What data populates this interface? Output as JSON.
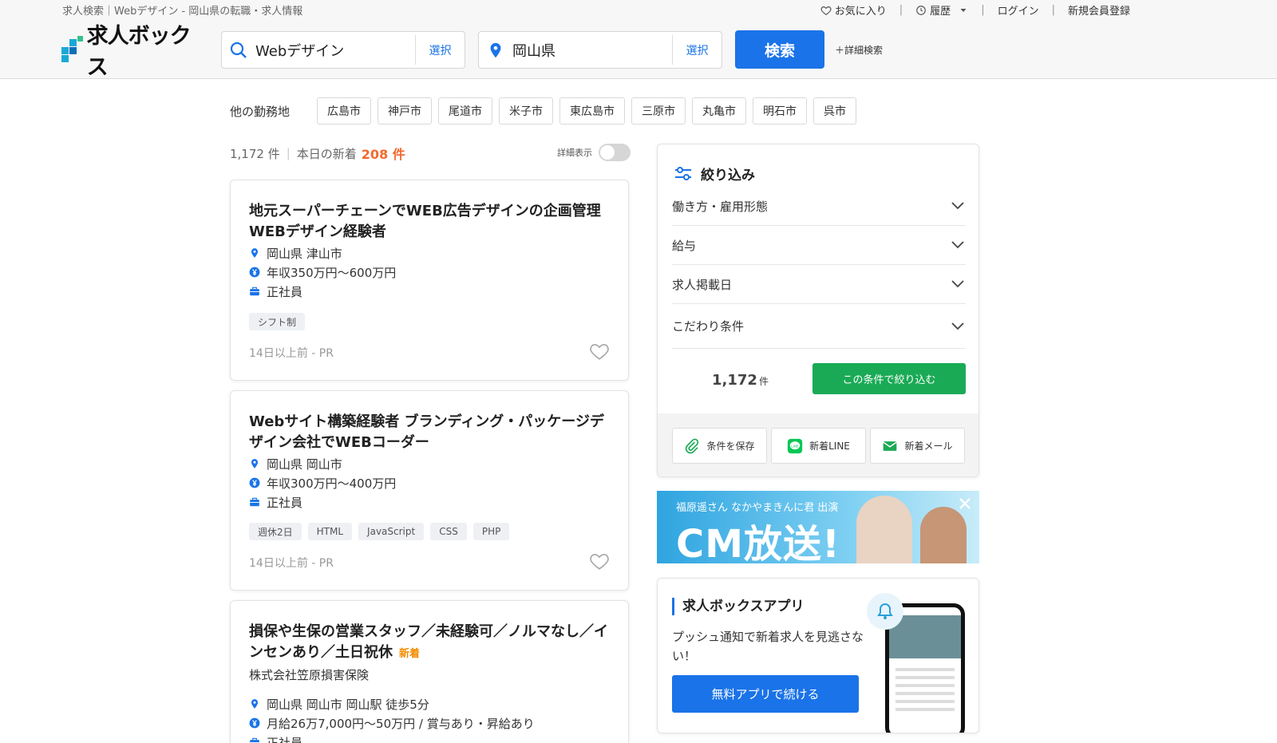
{
  "header": {
    "breadcrumb": "求人検索｜Webデザイン - 岡山県の転職・求人情報",
    "links": {
      "favorites": "お気に入り",
      "history": "履歴",
      "login": "ログイン",
      "signup": "新規会員登録"
    },
    "logo_text": "求人ボックス",
    "keyword_value": "Webデザイン",
    "keyword_select": "選択",
    "location_value": "岡山県",
    "location_select": "選択",
    "search_button": "検索",
    "advanced_search": "＋詳細検索"
  },
  "locations": {
    "label": "他の勤務地",
    "chips": [
      "広島市",
      "神戸市",
      "尾道市",
      "米子市",
      "東広島市",
      "三原市",
      "丸亀市",
      "明石市",
      "呉市"
    ]
  },
  "results": {
    "count": "1,172 件",
    "today_label": "本日の新着",
    "today_count": "208 件",
    "detail_toggle_label": "詳細表示"
  },
  "jobs": [
    {
      "title": "地元スーパーチェーンでWEB広告デザインの企画管理 WEBデザイン経験者",
      "location": "岡山県 津山市",
      "salary": "年収350万円〜600万円",
      "type": "正社員",
      "tags": [
        "シフト制"
      ],
      "posted": "14日以上前 - PR"
    },
    {
      "title": "Webサイト構築経験者 ブランディング・パッケージデザイン会社でWEBコーダー",
      "location": "岡山県 岡山市",
      "salary": "年収300万円〜400万円",
      "type": "正社員",
      "tags": [
        "週休2日",
        "HTML",
        "JavaScript",
        "CSS",
        "PHP"
      ],
      "posted": "14日以上前 - PR"
    },
    {
      "title": "損保や生保の営業スタッフ／未経験可／ノルマなし／インセンあり／土日祝休",
      "new_badge": "新着",
      "company": "株式会社笠原損害保険",
      "location": "岡山県 岡山市 岡山駅 徒歩5分",
      "salary": "月給26万7,000円〜50万円 / 賞与あり・昇給あり",
      "type": "正社員"
    }
  ],
  "filter": {
    "title": "絞り込み",
    "rows": [
      "働き方・雇用形態",
      "給与",
      "求人掲載日",
      "こだわり条件"
    ],
    "count": "1,172",
    "count_unit": "件",
    "apply_button": "この条件で絞り込む",
    "save_button": "条件を保存",
    "line_button": "新着LINE",
    "mail_button": "新着メール"
  },
  "banner": {
    "sub": "福原遥さん なかやまきんに君 出演",
    "main": "CM放送!"
  },
  "app": {
    "title": "求人ボックスアプリ",
    "desc": "プッシュ通知で新着求人を見逃さない！",
    "button": "無料アプリで続ける"
  },
  "colors": {
    "primary": "#1a73e8",
    "accent_new": "#f26a2e",
    "apply_green": "#1aaa55"
  }
}
